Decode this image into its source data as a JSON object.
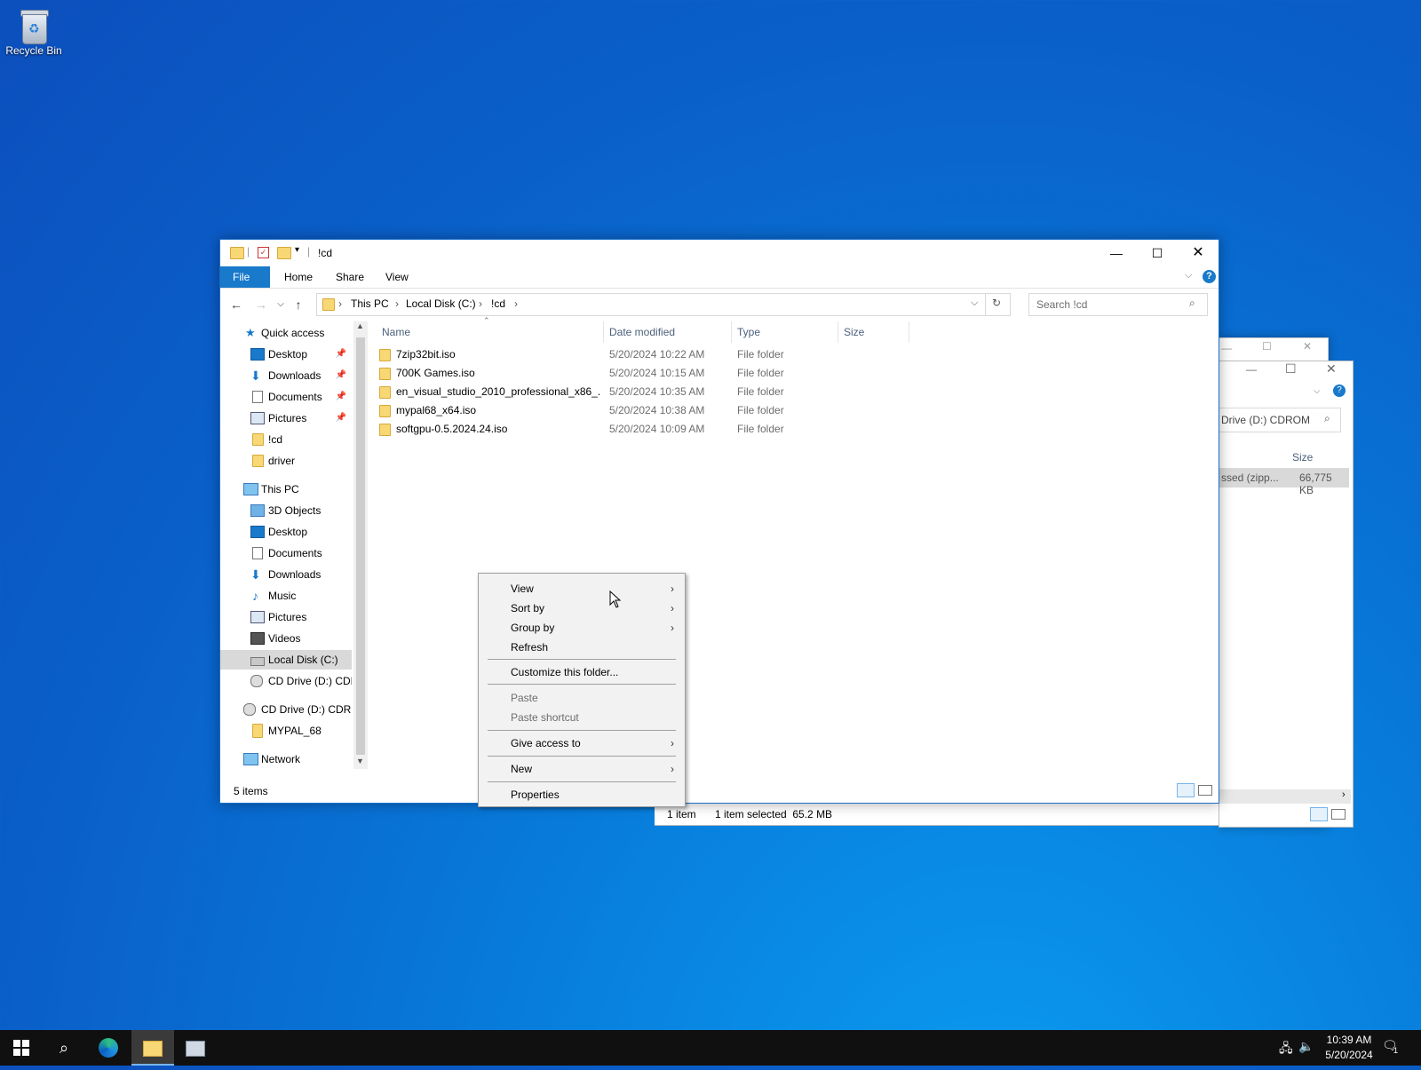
{
  "desktop": {
    "recycle_bin_label": "Recycle Bin"
  },
  "window": {
    "title": "!cd",
    "ribbon_tabs": [
      "File",
      "Home",
      "Share",
      "View"
    ],
    "breadcrumb": [
      "This PC",
      "Local Disk (C:)",
      "!cd"
    ],
    "search_placeholder": "Search !cd",
    "nav": {
      "quick_access": "Quick access",
      "quick_items": [
        "Desktop",
        "Downloads",
        "Documents",
        "Pictures",
        "!cd",
        "driver"
      ],
      "this_pc": "This PC",
      "pc_items": [
        "3D Objects",
        "Desktop",
        "Documents",
        "Downloads",
        "Music",
        "Pictures",
        "Videos",
        "Local Disk (C:)",
        "CD Drive (D:) CDR"
      ],
      "cd_drive": "CD Drive (D:) CDRO",
      "mypal": "MYPAL_68",
      "network": "Network"
    },
    "columns": [
      "Name",
      "Date modified",
      "Type",
      "Size"
    ],
    "files": [
      {
        "name": "7zip32bit.iso",
        "date": "5/20/2024 10:22 AM",
        "type": "File folder"
      },
      {
        "name": "700K Games.iso",
        "date": "5/20/2024 10:15 AM",
        "type": "File folder"
      },
      {
        "name": "en_visual_studio_2010_professional_x86_...",
        "date": "5/20/2024 10:35 AM",
        "type": "File folder"
      },
      {
        "name": "mypal68_x64.iso",
        "date": "5/20/2024 10:38 AM",
        "type": "File folder"
      },
      {
        "name": "softgpu-0.5.2024.24.iso",
        "date": "5/20/2024 10:09 AM",
        "type": "File folder"
      }
    ],
    "status": "5 items"
  },
  "back_window": {
    "search_text": "Drive (D:) CDROM",
    "size_header": "Size",
    "row_type": "ssed (zipp...",
    "row_size": "66,775 KB",
    "status_count": "1 item",
    "status_selected": "1 item selected  65.2 MB"
  },
  "context_menu": {
    "items": [
      {
        "label": "View",
        "submenu": true,
        "disabled": false
      },
      {
        "label": "Sort by",
        "submenu": true,
        "disabled": false
      },
      {
        "label": "Group by",
        "submenu": true,
        "disabled": false
      },
      {
        "label": "Refresh",
        "submenu": false,
        "disabled": false
      },
      {
        "label": "Customize this folder...",
        "submenu": false,
        "disabled": false
      },
      {
        "label": "Paste",
        "submenu": false,
        "disabled": true
      },
      {
        "label": "Paste shortcut",
        "submenu": false,
        "disabled": true
      },
      {
        "label": "Give access to",
        "submenu": true,
        "disabled": false
      },
      {
        "label": "New",
        "submenu": true,
        "disabled": false
      },
      {
        "label": "Properties",
        "submenu": false,
        "disabled": false
      }
    ]
  },
  "taskbar": {
    "time": "10:39 AM",
    "date": "5/20/2024",
    "notification_count": "1"
  }
}
